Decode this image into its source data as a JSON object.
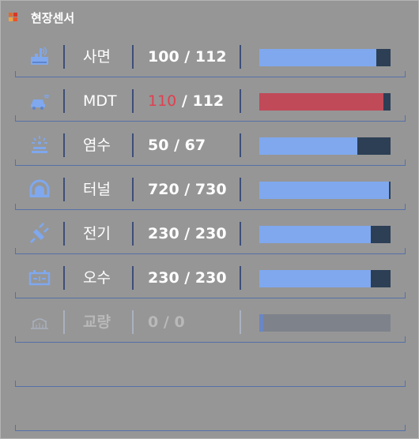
{
  "panel": {
    "title": "현장센서",
    "title_icon": "sensor-grid-icon",
    "accent_colors": {
      "bar_fill": "#7fa8ee",
      "bar_track": "#2c3f55",
      "alert": "#c04a58",
      "alert_text": "#e04050",
      "divider": "#5670a8"
    }
  },
  "sensors": [
    {
      "label": "사면",
      "icon": "slope-sensor-icon",
      "current": "100",
      "total": "112",
      "ratio": 0.8929,
      "status": "normal"
    },
    {
      "label": "MDT",
      "icon": "mdt-vehicle-icon",
      "current": "110",
      "total": "112",
      "ratio": 0.9464,
      "status": "alert"
    },
    {
      "label": "염수",
      "icon": "brine-spray-icon",
      "current": "50",
      "total": "67",
      "ratio": 0.7463,
      "status": "normal"
    },
    {
      "label": "터널",
      "icon": "tunnel-icon",
      "current": "720",
      "total": "730",
      "ratio": 0.9863,
      "status": "normal"
    },
    {
      "label": "전기",
      "icon": "power-plug-icon",
      "current": "230",
      "total": "230",
      "ratio": 0.85,
      "status": "normal"
    },
    {
      "label": "오수",
      "icon": "sewage-tank-icon",
      "current": "230",
      "total": "230",
      "ratio": 0.85,
      "status": "normal"
    },
    {
      "label": "교량",
      "icon": "bridge-icon",
      "current": "0",
      "total": "0",
      "ratio": 0.03,
      "status": "disabled"
    }
  ],
  "separator": "/"
}
